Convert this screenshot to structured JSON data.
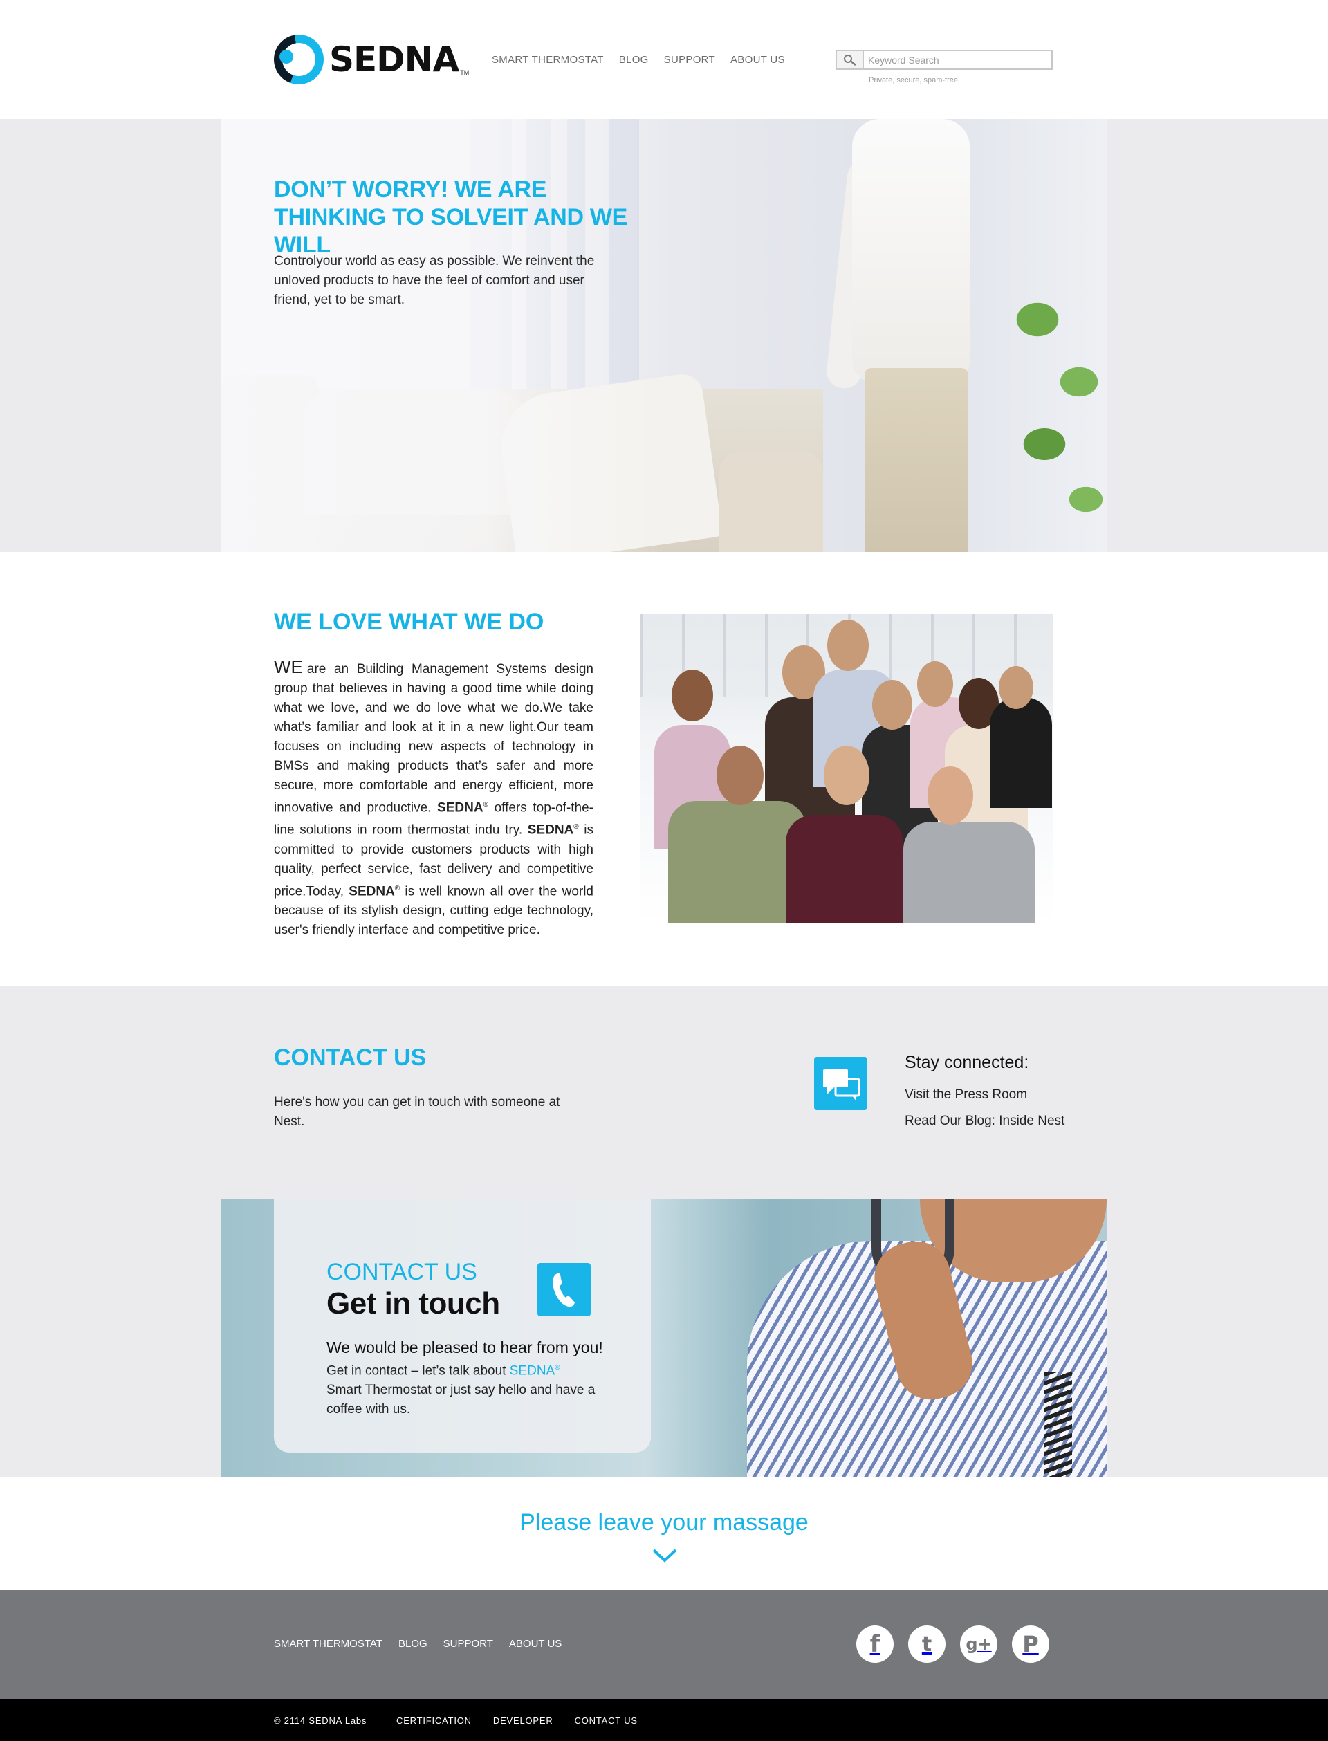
{
  "header": {
    "logo_text": "SEDNA",
    "logo_tm": "TM",
    "nav": [
      "SMART THERMOSTAT",
      "BLOG",
      "SUPPORT",
      "ABOUT US"
    ],
    "search_placeholder": "Keyword Search",
    "search_note": "Private, secure, spam-free"
  },
  "hero": {
    "title": "DON’T WORRY! WE ARE THINKING TO SOLVEIT AND WE WILL",
    "text": "Controlyour world as easy as possible. We reinvent the unloved products to have the feel of comfort and user friend, yet to be smart."
  },
  "about": {
    "title": "WE LOVE WHAT WE DO",
    "we": "WE",
    "p1": "are an Building Management Systems design group that believes in having a good time while doing what we love, and we do love what we do.We take what’s familiar and look at it in a new light.Our team focuses on including new aspects of technology in BMSs and making products that’s safer and more secure, more comfortable and energy efficient, more innovative and productive.",
    "brand": "SEDNA",
    "reg": "®",
    "p2": " offers top-of-the-line solutions in room thermostat indu try. ",
    "p3": " is committed to provide customers products with high quality, perfect service, fast delivery and competitive price.Today, ",
    "p4": " is well known all over the world because of its stylish design, cutting edge technology, user's friendly interface and competitive price."
  },
  "contact": {
    "title": "CONTACT US",
    "text": "Here's how you can get in touch with someone  at Nest.",
    "stay_title": "Stay connected:",
    "link_press": "Visit the Press Room",
    "link_blog": "Read Our Blog: Inside Nest"
  },
  "touch": {
    "label": "CONTACT US",
    "title": "Get in touch",
    "lead": "We would be pleased to hear from you!",
    "text_before": "Get in contact – let’s talk about ",
    "brand": "SEDNA",
    "reg": "®",
    "text_after": " Smart Thermostat or just say hello and have a coffee with us."
  },
  "message": {
    "title": "Please leave your massage"
  },
  "footer": {
    "nav": [
      "SMART THERMOSTAT",
      "BLOG",
      "SUPPORT",
      "ABOUT US"
    ],
    "social": [
      {
        "name": "facebook-icon",
        "glyph": "f"
      },
      {
        "name": "twitter-icon",
        "glyph": "t"
      },
      {
        "name": "google-plus-icon",
        "glyph": "g+"
      },
      {
        "name": "pinterest-icon",
        "glyph": "P"
      }
    ],
    "copyright": "© 2114 SEDNA Labs",
    "bottom_nav": [
      "CERTIFICATION",
      "DEVELOPER",
      "CONTACT US"
    ]
  },
  "colors": {
    "accent": "#16b3e6",
    "band": "#ebebee",
    "footer": "#76777a",
    "bottom": "#000000"
  }
}
